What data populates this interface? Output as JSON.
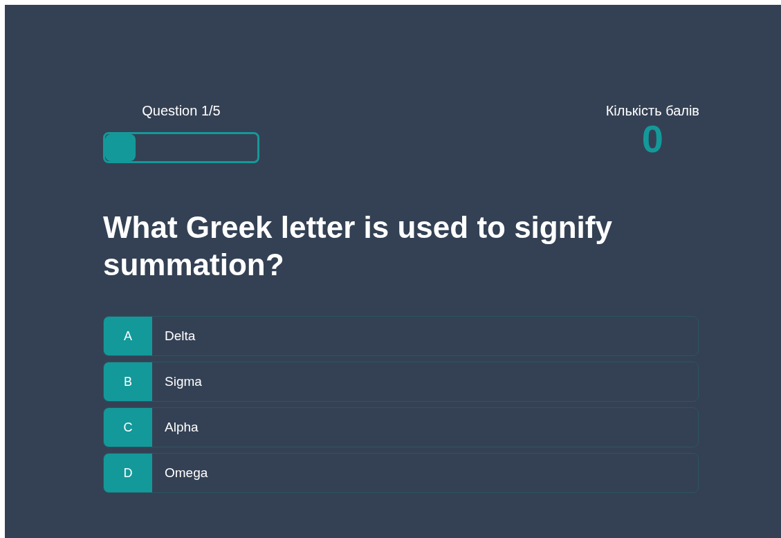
{
  "progress": {
    "label": "Question 1/5",
    "level": 0.2
  },
  "score": {
    "label": "Кількість балів",
    "value": "0"
  },
  "question": "What Greek letter is used to signify summation?",
  "options": [
    {
      "letter": "A",
      "text": "Delta"
    },
    {
      "letter": "B",
      "text": "Sigma"
    },
    {
      "letter": "C",
      "text": "Alpha"
    },
    {
      "letter": "D",
      "text": "Omega"
    }
  ]
}
